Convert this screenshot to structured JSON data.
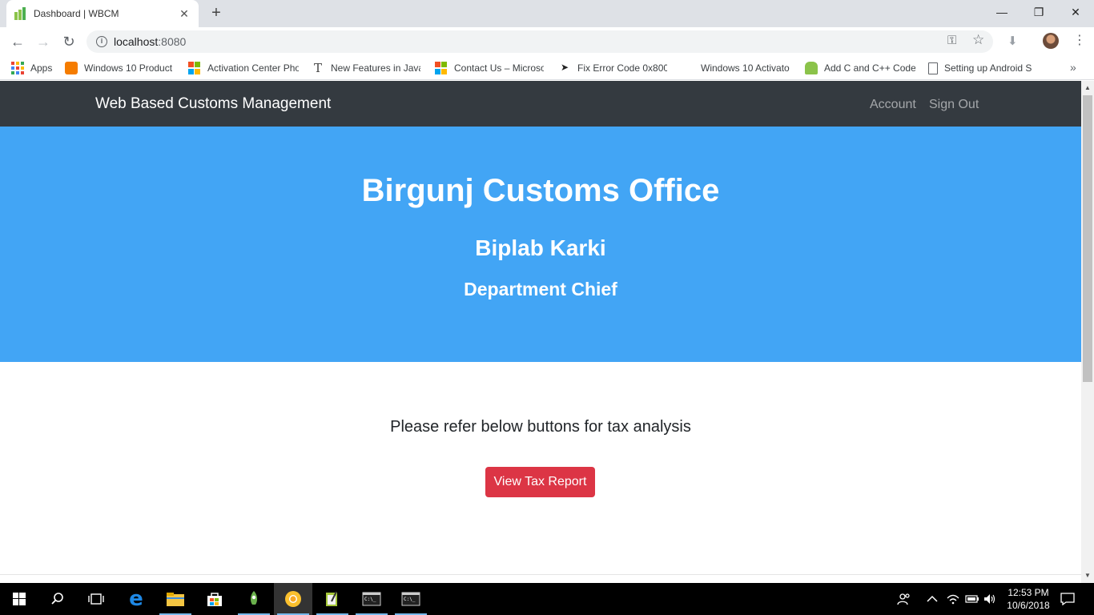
{
  "browser": {
    "tab_title": "Dashboard | WBCM",
    "tab_close": "✕",
    "new_tab": "+",
    "minimize": "—",
    "restore": "❐",
    "close": "✕",
    "url_host": "localhost",
    "url_port": ":8080",
    "back": "←",
    "forward": "→",
    "reload": "↻",
    "key_icon": "⚿",
    "star_icon": "☆",
    "download_icon": "⬇",
    "menu_icon": "⋮"
  },
  "bookmarks": {
    "apps": "Apps",
    "items": [
      "Windows 10 Product",
      "Activation Center Pho",
      "New Features in Java",
      "Contact Us – Microso",
      "Fix Error Code 0x800",
      "Windows 10 Activato",
      "Add C and C++ Code",
      "Setting up Android S"
    ],
    "more": "»"
  },
  "navbar": {
    "brand": "Web Based Customs Management",
    "account": "Account",
    "sign_out": "Sign Out"
  },
  "hero": {
    "office": "Birgunj Customs Office",
    "user_name": "Biplab Karki",
    "role": "Department Chief"
  },
  "main": {
    "lead": "Please refer below buttons for tax analysis",
    "button": "View Tax Report"
  },
  "taskbar": {
    "time": "12:53 PM",
    "date": "10/6/2018"
  },
  "colors": {
    "navbar": "#343a40",
    "hero": "#42a5f5",
    "button": "#dc3545"
  }
}
